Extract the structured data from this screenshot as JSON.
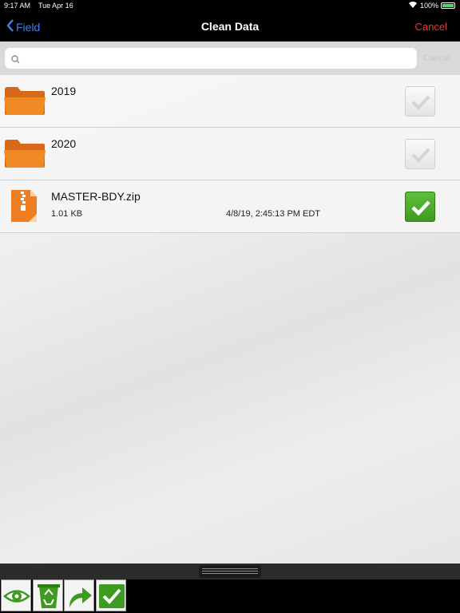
{
  "status_bar": {
    "time": "9:17 AM",
    "date": "Tue Apr 16",
    "battery": "100%"
  },
  "nav": {
    "back_label": "Field",
    "title": "Clean Data",
    "cancel_label": "Cancel"
  },
  "search": {
    "value": "",
    "placeholder": "",
    "cancel_label": "Cancel"
  },
  "files": [
    {
      "name": "2019",
      "type": "folder",
      "size": "",
      "date": "",
      "checked": false
    },
    {
      "name": "2020",
      "type": "folder",
      "size": "",
      "date": "",
      "checked": false
    },
    {
      "name": "MASTER-BDY.zip",
      "type": "zip",
      "size": "1.01 KB",
      "date": "4/8/19, 2:45:13 PM EDT",
      "checked": true
    }
  ],
  "toolbar": {
    "buttons": [
      "eye-icon",
      "recycle-bin-icon",
      "share-arrow-icon",
      "checkmark-icon"
    ]
  },
  "colors": {
    "accent": "#3b82f6",
    "cancel": "#e53935",
    "folder": "#f08a24",
    "check_on": "#4caf2f"
  }
}
